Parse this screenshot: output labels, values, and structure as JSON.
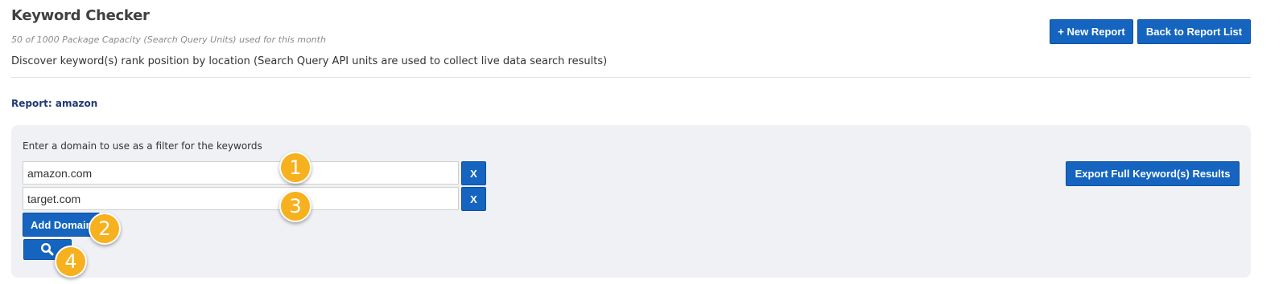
{
  "header": {
    "title": "Keyword Checker",
    "capacity_note": "50 of 1000 Package Capacity (Search Query Units) used for this month",
    "description": "Discover keyword(s) rank position by location (Search Query API units are used to collect live data search results)",
    "new_report_label": "+ New Report",
    "back_label": "Back to Report List"
  },
  "report": {
    "label": "Report: amazon"
  },
  "filter": {
    "label": "Enter a domain to use as a filter for the keywords",
    "domains": [
      "amazon.com",
      "target.com"
    ],
    "remove_label": "X",
    "add_domain_label": "Add Domain",
    "export_label": "Export Full Keyword(s) Results",
    "search_icon": "search-icon"
  },
  "callouts": [
    "1",
    "2",
    "3",
    "4"
  ],
  "colors": {
    "primary_button": "#1565c0",
    "panel_background": "#f0f1f5",
    "callout_badge": "#f7b11e",
    "report_label": "#1f3a73"
  }
}
